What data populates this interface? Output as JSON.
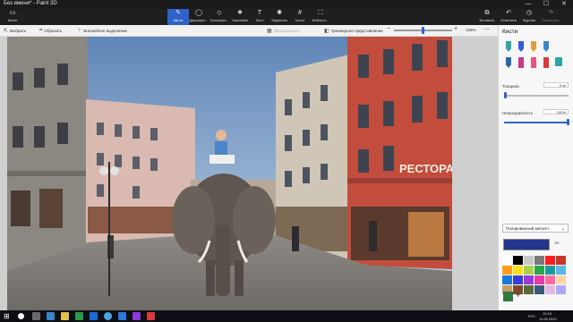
{
  "window": {
    "title": "Без имени* - Paint 3D",
    "buttons": [
      "—",
      "☐",
      "✕"
    ]
  },
  "ribbon": {
    "menu_label": "Меню",
    "items": [
      {
        "label": "Кисти",
        "icon": "✎",
        "active": true
      },
      {
        "label": "Двухмерн...",
        "icon": "◯"
      },
      {
        "label": "Трехмерн...",
        "icon": "◇"
      },
      {
        "label": "Наклейки",
        "icon": "❖"
      },
      {
        "label": "Текст",
        "icon": "T"
      },
      {
        "label": "Эффекты",
        "icon": "✺"
      },
      {
        "label": "Холст",
        "icon": "#"
      },
      {
        "label": "Библиот...",
        "icon": "⛶"
      }
    ],
    "right_items": [
      {
        "label": "Вставить",
        "icon": "⧉"
      },
      {
        "label": "Отменить",
        "icon": "↶"
      },
      {
        "label": "Журнал",
        "icon": "◷"
      },
      {
        "label": "Повторить",
        "icon": "↷"
      }
    ]
  },
  "tools": {
    "select": "Выбрать",
    "crop": "Обрезать",
    "magic_select": "Волшебное выделение",
    "transparency": "Прозрачность",
    "view_3d": "Трехмерное представление",
    "zoom_value": "125%",
    "zoom_level": 0.5
  },
  "panel": {
    "title": "Кисти",
    "thickness_label": "Толщина",
    "thickness_value": "5 пк",
    "opacity_label": "Непрозрачность",
    "opacity_value": "100%",
    "material": "Полированный металл",
    "current_color": "#23358f",
    "swatches": [
      "#ffffff",
      "#000000",
      "#c8c8c8",
      "#7a7a7a",
      "#ff1a1a",
      "#c6372a",
      "#ff9d1a",
      "#ffdf1a",
      "#a8d24a",
      "#2aa64a",
      "#1a9a9a",
      "#5bb7e6",
      "#1a7ad9",
      "#3a3ad9",
      "#9a3ad9",
      "#e63aa6",
      "#ff6d9d",
      "#ffd6a6",
      "#c89a6a",
      "#7a4a2a",
      "#5a6a3a",
      "#3a5a7a",
      "#e6b8e0",
      "#a8a8ff"
    ],
    "custom_color": "#2f7a3c"
  },
  "taskbar": {
    "time": "19:13",
    "date": "11.06.2020",
    "lang": "РУС"
  },
  "scene": {
    "sign_text": "РЕСТОРА"
  }
}
